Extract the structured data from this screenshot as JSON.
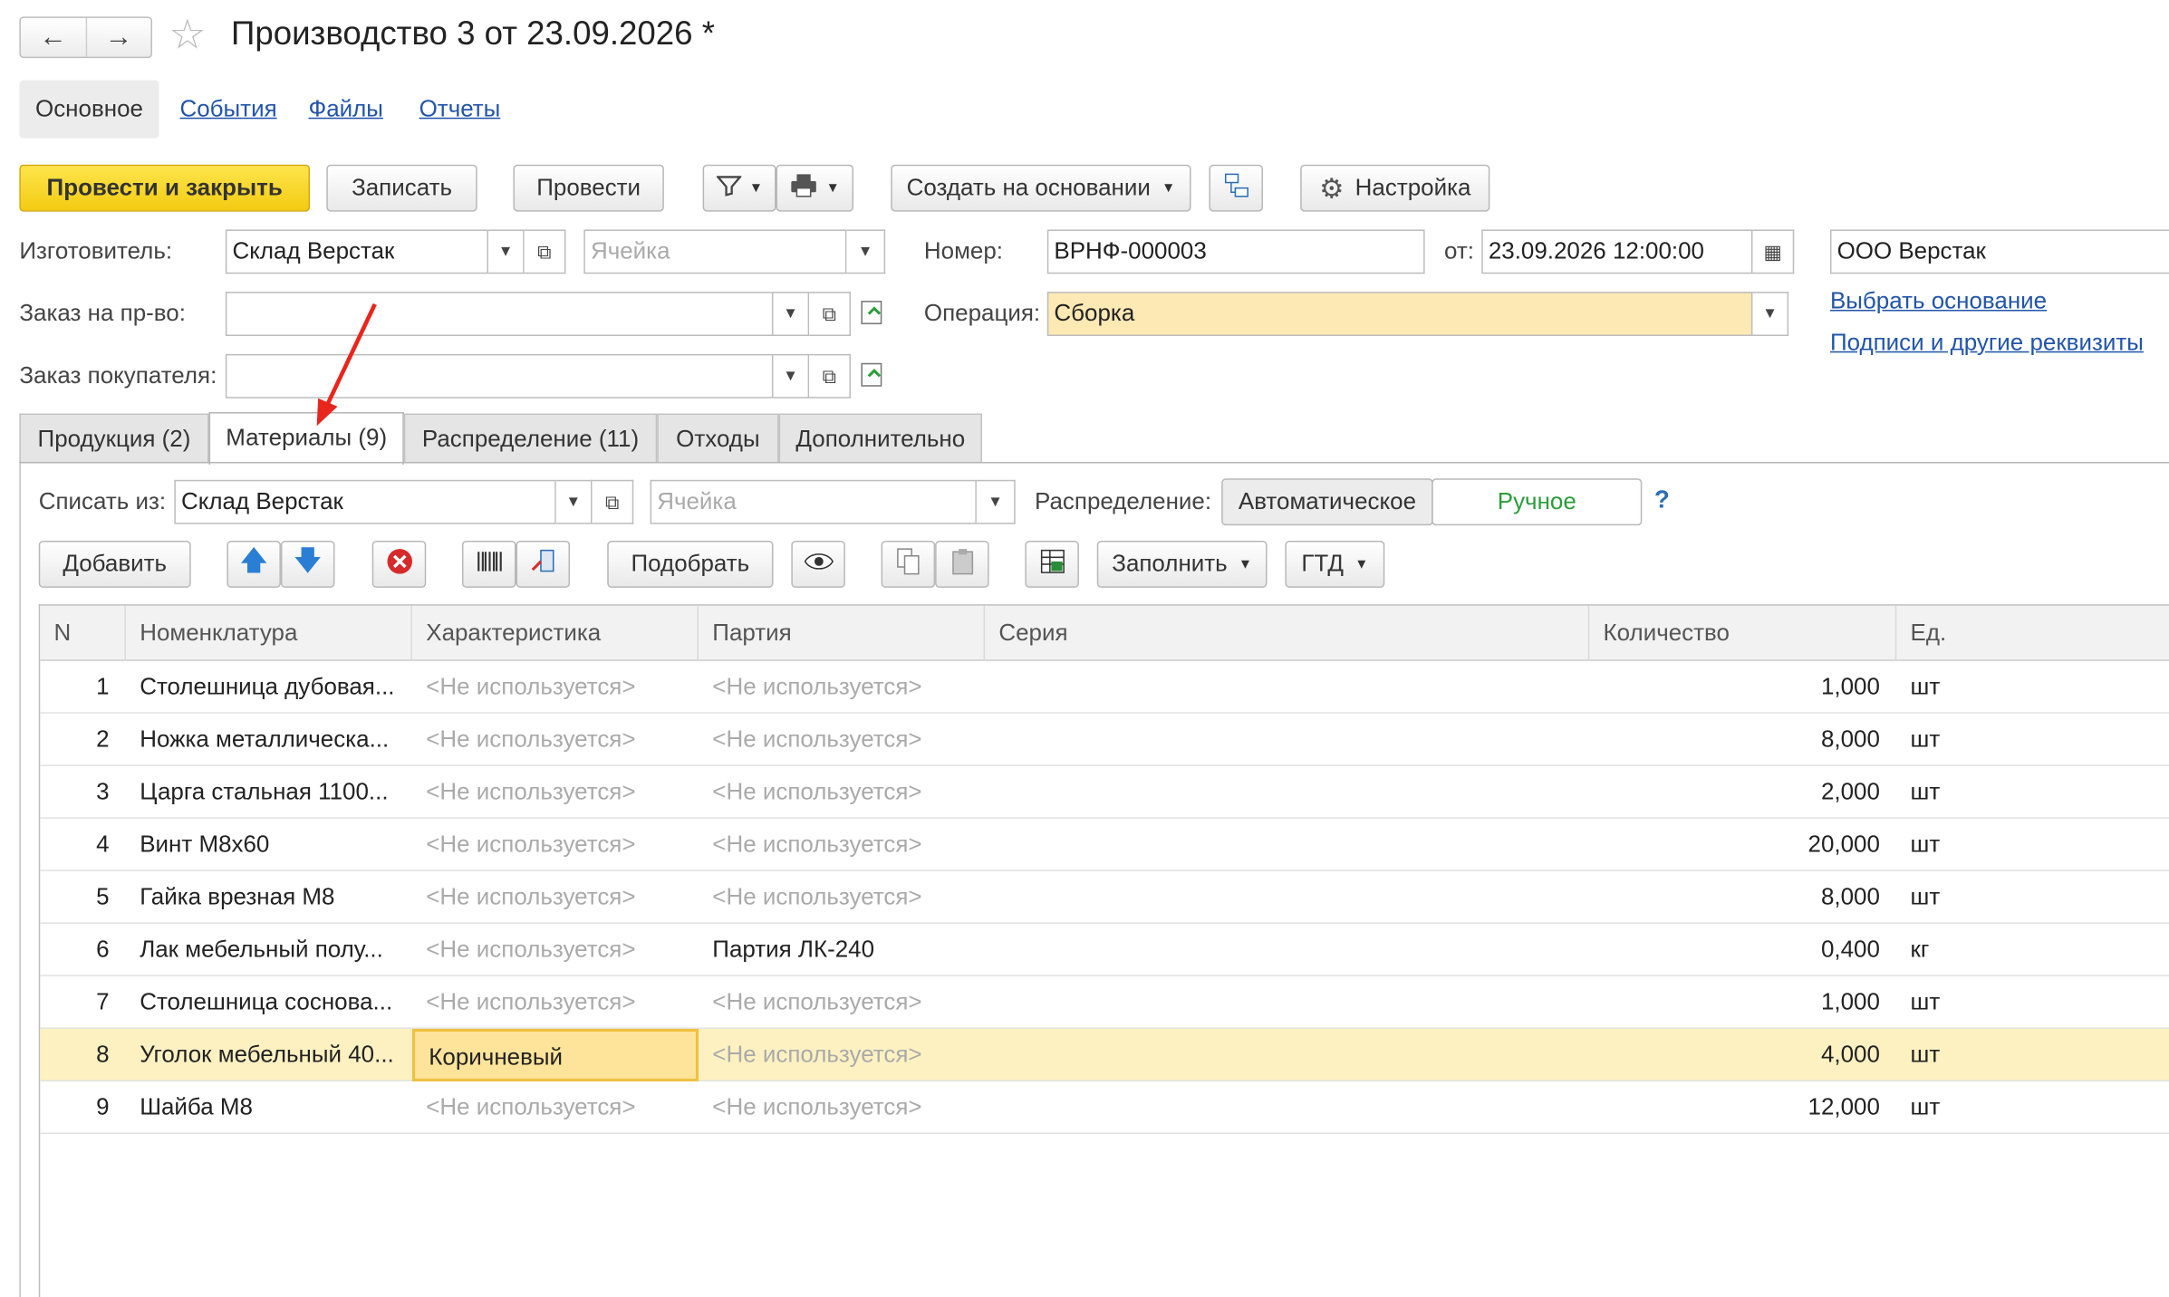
{
  "header": {
    "title": "Производство 3 от 23.09.2026 *",
    "back": "←",
    "forward": "→",
    "star": "☆"
  },
  "top_tabs": {
    "main": "Основное",
    "events": "События",
    "files": "Файлы",
    "reports": "Отчеты"
  },
  "toolbar": {
    "post_close": "Провести и закрыть",
    "save": "Записать",
    "post": "Провести",
    "create_based": "Создать на основании",
    "settings": "Настройка"
  },
  "form": {
    "manufacturer_label": "Изготовитель:",
    "manufacturer_value": "Склад Верстак",
    "cell_placeholder": "Ячейка",
    "prod_order_label": "Заказ на пр-во:",
    "customer_order_label": "Заказ покупателя:",
    "number_label": "Номер:",
    "number_value": "ВРНФ-000003",
    "date_label": "от:",
    "date_value": "23.09.2026 12:00:00",
    "org_value": "ООО Верстак",
    "operation_label": "Операция:",
    "operation_value": "Сборка",
    "choose_basis": "Выбрать основание",
    "signatures": "Подписи и другие реквизиты"
  },
  "tabs": [
    "Продукция (2)",
    "Материалы (9)",
    "Распределение (11)",
    "Отходы",
    "Дополнительно"
  ],
  "materials": {
    "writeoff_label": "Списать из:",
    "writeoff_value": "Склад Верстак",
    "cell_placeholder": "Ячейка",
    "distribution_label": "Распределение:",
    "auto": "Автоматическое",
    "manual": "Ручное",
    "help": "?",
    "add": "Добавить",
    "pick": "Подобрать",
    "fill": "Заполнить",
    "gtd": "ГТД"
  },
  "table": {
    "columns": [
      "N",
      "Номенклатура",
      "Характеристика",
      "Партия",
      "Серия",
      "Количество",
      "Ед."
    ],
    "rows": [
      [
        "1",
        "Столешница дубовая...",
        "<Не используется>",
        "<Не используется>",
        "",
        "1,000",
        "шт"
      ],
      [
        "2",
        "Ножка металлическа...",
        "<Не используется>",
        "<Не используется>",
        "",
        "8,000",
        "шт"
      ],
      [
        "3",
        "Царга стальная 1100...",
        "<Не используется>",
        "<Не используется>",
        "",
        "2,000",
        "шт"
      ],
      [
        "4",
        "Винт М8х60",
        "<Не используется>",
        "<Не используется>",
        "",
        "20,000",
        "шт"
      ],
      [
        "5",
        "Гайка врезная М8",
        "<Не используется>",
        "<Не используется>",
        "",
        "8,000",
        "шт"
      ],
      [
        "6",
        "Лак мебельный полу...",
        "<Не используется>",
        "Партия ЛК-240",
        "",
        "0,400",
        "кг"
      ],
      [
        "7",
        "Столешница соснова...",
        "<Не используется>",
        "<Не используется>",
        "",
        "1,000",
        "шт"
      ],
      [
        "8",
        "Уголок мебельный 40...",
        "Коричневый",
        "<Не используется>",
        "",
        "4,000",
        "шт"
      ],
      [
        "9",
        "Шайба М8",
        "<Не используется>",
        "<Не используется>",
        "",
        "12,000",
        "шт"
      ]
    ]
  },
  "colors": {
    "accent_yellow": "#f5cf1c",
    "link": "#2255aa",
    "selected_row": "#fdf1c2",
    "annotation_arrow": "#e8261c"
  }
}
